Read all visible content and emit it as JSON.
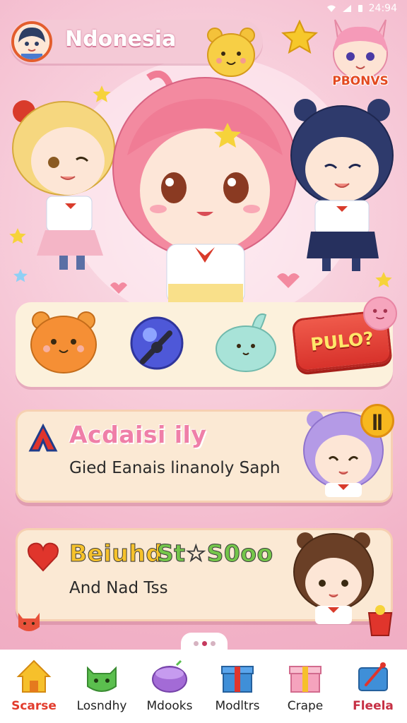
{
  "status": {
    "time": "24:94"
  },
  "header": {
    "title": "Ndonesia"
  },
  "badge": {
    "label": "PBONVS"
  },
  "items": {
    "pull_label": "PULO?"
  },
  "events": [
    {
      "title": "Acdaisi ily",
      "subtitle": "Gied Eanais linanoly Saph",
      "title_color": "#ef7fa8"
    },
    {
      "title_part1": "Beiuhd",
      "title_part2": "St☆S0oo",
      "subtitle": "And Nad Tss"
    }
  ],
  "nav": {
    "items": [
      {
        "label": "Scarse",
        "icon": "house-icon",
        "active": true
      },
      {
        "label": "Losndhy",
        "icon": "green-cat-icon"
      },
      {
        "label": "Mdooks",
        "icon": "purple-bowl-icon"
      },
      {
        "label": "Modltrs",
        "icon": "blue-gift-icon"
      },
      {
        "label": "Crape",
        "icon": "pink-gift-icon"
      },
      {
        "label": "Fleela",
        "icon": "pen-tablet-icon"
      }
    ]
  },
  "colors": {
    "accent": "#e23b2c",
    "bg": "#f3b8cc",
    "card": "#fbe9d4"
  }
}
